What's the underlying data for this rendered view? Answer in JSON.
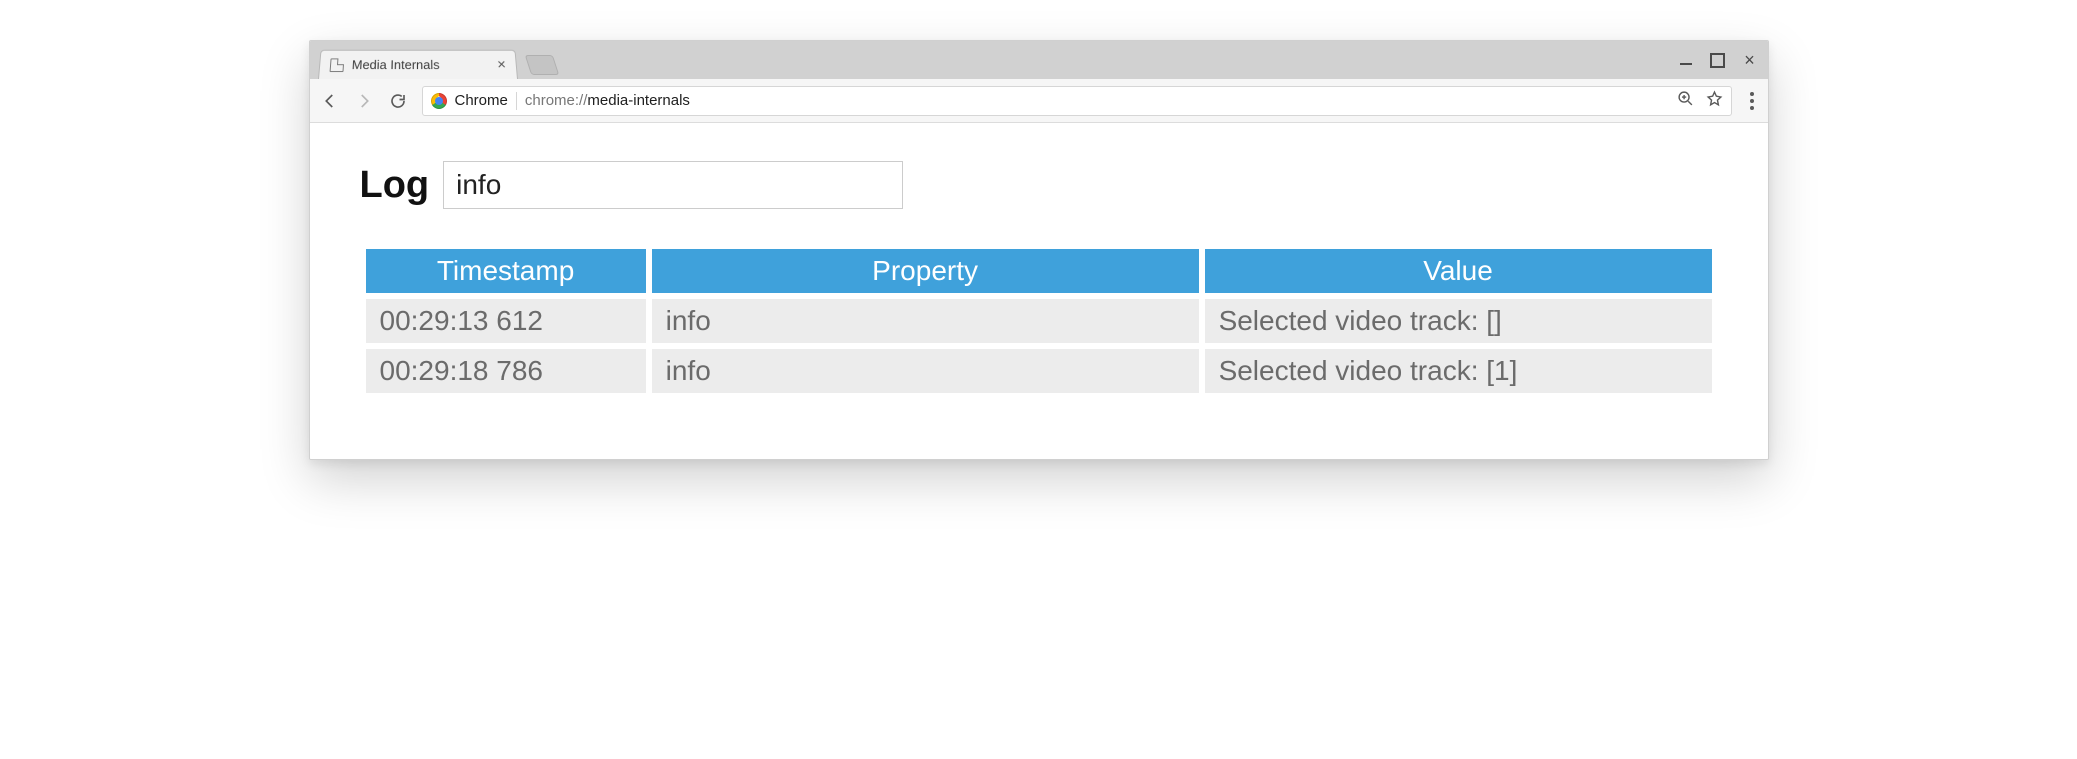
{
  "browser": {
    "tab_title": "Media Internals",
    "scheme_label": "Chrome",
    "url_host": "chrome://",
    "url_path": "media-internals"
  },
  "page": {
    "heading": "Log",
    "filter_value": "info",
    "columns": [
      "Timestamp",
      "Property",
      "Value"
    ],
    "rows": [
      {
        "timestamp": "00:29:13 612",
        "property": "info",
        "value": "Selected video track: []"
      },
      {
        "timestamp": "00:29:18 786",
        "property": "info",
        "value": "Selected video track: [1]"
      }
    ]
  }
}
